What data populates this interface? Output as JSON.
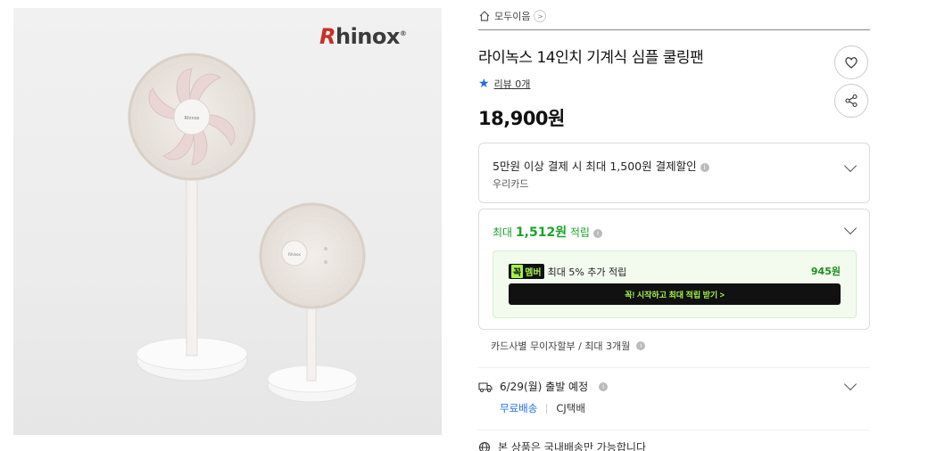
{
  "product_image": {
    "brand_logo_first": "R",
    "brand_logo_rest": "hinox",
    "brand_mark": "®",
    "fan_badge_text": "Rhinox"
  },
  "breadcrumb": {
    "home_icon": "home-icon",
    "label": "모두이음",
    "chevron": ">"
  },
  "product": {
    "title": "라이녹스 14인치 기계식 심플 쿨링팬",
    "review_label": "리뷰 0개",
    "price": "18,900원"
  },
  "actions": {
    "wishlist_icon": "heart-icon",
    "share_icon": "share-icon"
  },
  "card_discount": {
    "line1": "5만원 이상 결제 시 최대 1,500원 결제할인",
    "line2": "우리카드"
  },
  "points": {
    "prefix": "최대 ",
    "amount": "1,512원",
    "suffix": " 적립",
    "member_badge_left": "꼭",
    "member_badge_right": "멤버",
    "member_text": "최대 5% 추가 적립",
    "member_amount": "945원",
    "cta_label": "꼭! 시작하고 최대 적립 받기  >"
  },
  "installment": {
    "text": "카드사별 무이자할부 / 최대 3개월"
  },
  "shipping": {
    "date_text": "6/29(월) 출발 예정",
    "free_label": "무료배송",
    "carrier": "CJ택배",
    "domestic_text": "본 상품은 국내배송만 가능합니다"
  },
  "colors": {
    "accent_green": "#1aa32a",
    "member_green": "#a6f24a",
    "link_blue": "#1f6fe0",
    "brand_red": "#c8302a"
  }
}
